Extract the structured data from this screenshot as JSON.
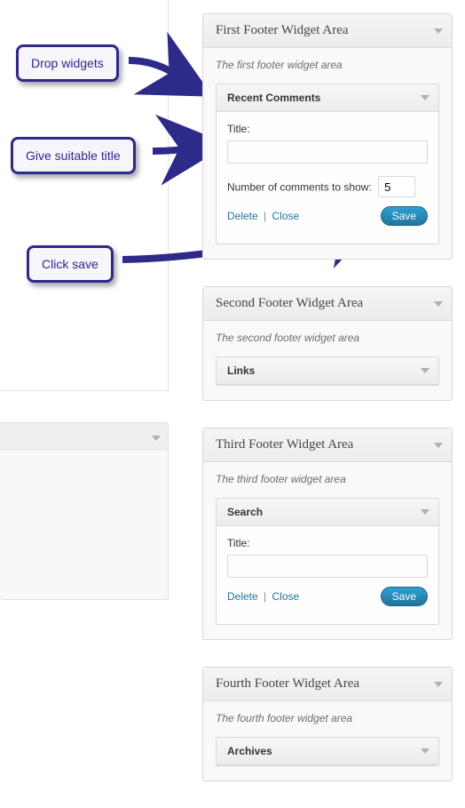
{
  "callouts": {
    "drop": "Drop widgets",
    "title": "Give suitable title",
    "save": "Click save"
  },
  "areas": {
    "first": {
      "title": "First Footer Widget Area",
      "desc": "The first footer widget area",
      "widget": {
        "name": "Recent Comments",
        "title_label": "Title:",
        "title_value": "",
        "num_label": "Number of comments to show:",
        "num_value": "5",
        "delete": "Delete",
        "close": "Close",
        "save": "Save"
      }
    },
    "second": {
      "title": "Second Footer Widget Area",
      "desc": "The second footer widget area",
      "widget": {
        "name": "Links"
      }
    },
    "third": {
      "title": "Third Footer Widget Area",
      "desc": "The third footer widget area",
      "widget": {
        "name": "Search",
        "title_label": "Title:",
        "title_value": "",
        "delete": "Delete",
        "close": "Close",
        "save": "Save"
      }
    },
    "fourth": {
      "title": "Fourth Footer Widget Area",
      "desc": "The fourth footer widget area",
      "widget": {
        "name": "Archives"
      }
    }
  }
}
